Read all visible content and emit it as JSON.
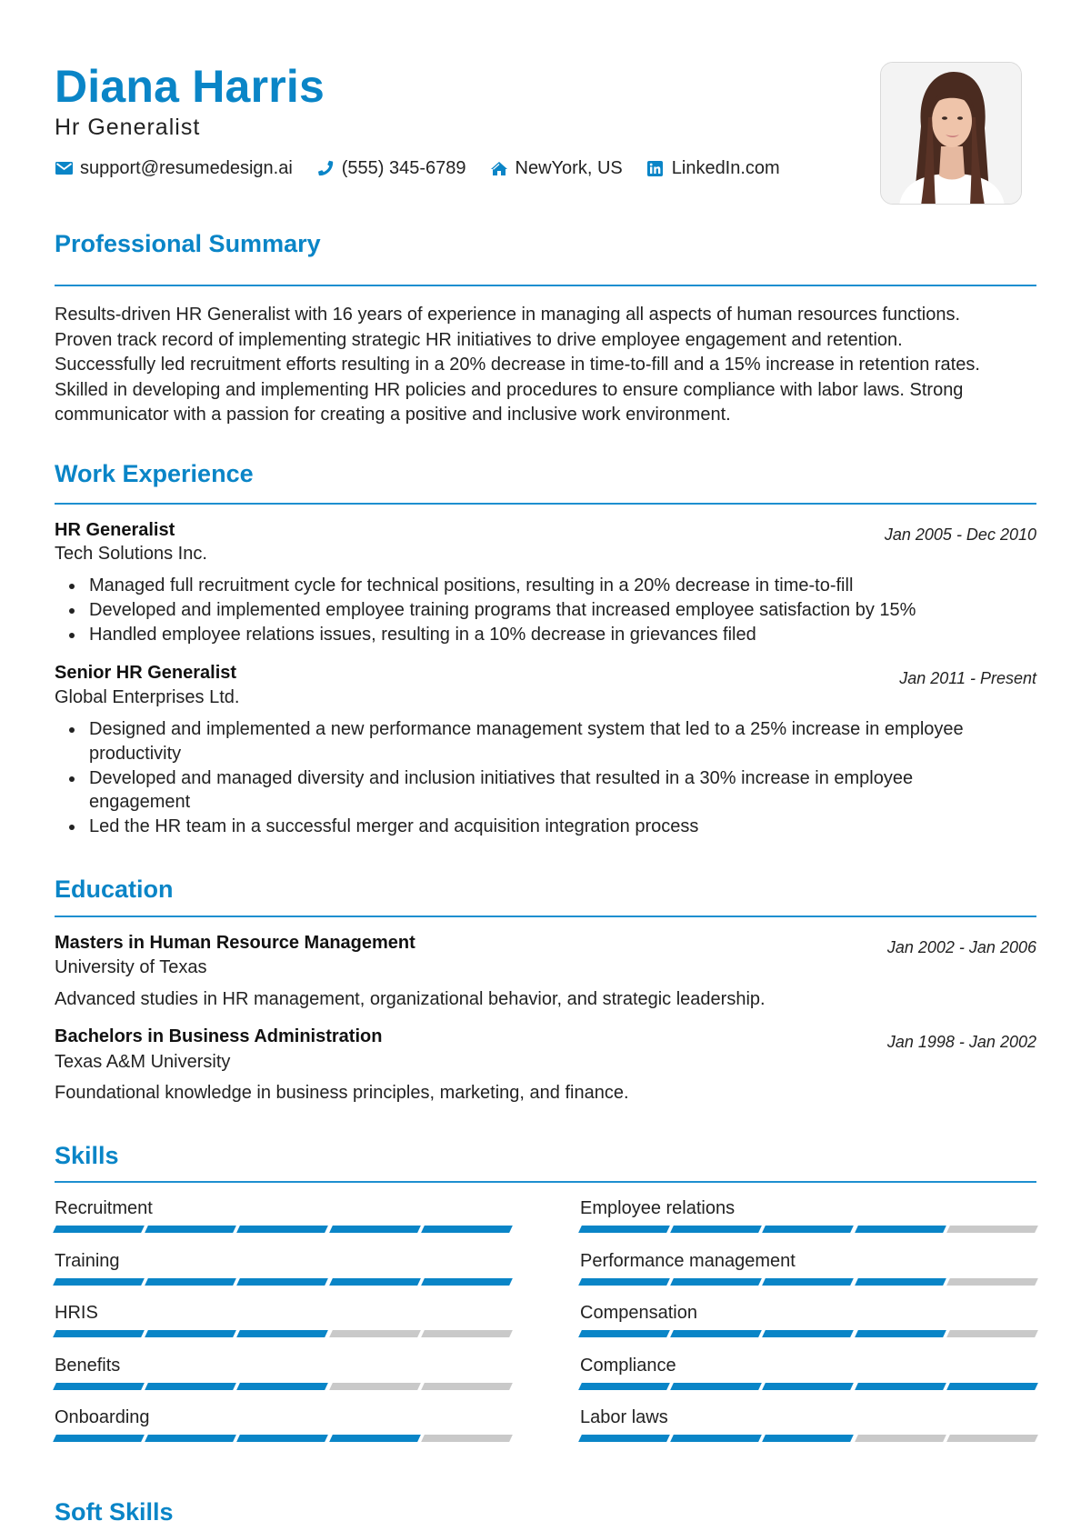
{
  "header": {
    "name": "Diana Harris",
    "title": "Hr Generalist",
    "contacts": [
      {
        "icon": "envelope-icon",
        "label": "support@resumedesign.ai"
      },
      {
        "icon": "phone-icon",
        "label": "(555) 345-6789"
      },
      {
        "icon": "home-icon",
        "label": "NewYork, US"
      },
      {
        "icon": "linkedin-icon",
        "label": "LinkedIn.com"
      }
    ],
    "photo_alt": "Profile photo"
  },
  "colors": {
    "accent": "#0a85c7",
    "skill_empty": "#c9c9c9",
    "text": "#222222"
  },
  "summary": {
    "heading": "Professional Summary",
    "lines": [
      "Results-driven HR Generalist with 16 years of experience in managing all aspects of human resources functions.",
      "Proven track record of implementing strategic HR initiatives to drive employee engagement and retention.",
      "Successfully led recruitment efforts resulting in a 20% decrease in time-to-fill and a 15% increase in retention rates.",
      "Skilled in developing and implementing HR policies and procedures to ensure compliance with labor laws. Strong",
      "communicator with a passion for creating a positive and inclusive work environment."
    ]
  },
  "experience": {
    "heading": "Work Experience",
    "jobs": [
      {
        "role": "HR Generalist",
        "company": "Tech Solutions Inc.",
        "dates": "Jan 2005 - Dec 2010",
        "bullets": [
          "Managed full recruitment cycle for technical positions, resulting in a 20% decrease in time-to-fill",
          "Developed and implemented employee training programs that increased employee satisfaction by 15%",
          "Handled employee relations issues, resulting in a 10% decrease in grievances filed"
        ]
      },
      {
        "role": "Senior HR Generalist",
        "company": "Global Enterprises Ltd.",
        "dates": "Jan 2011 - Present",
        "bullets": [
          "Designed and implemented a new performance management system that led to a 25% increase in employee productivity",
          "Developed and managed diversity and inclusion initiatives that resulted in a 30% increase in employee engagement",
          "Led the HR team in a successful merger and acquisition integration process"
        ]
      }
    ]
  },
  "education": {
    "heading": "Education",
    "items": [
      {
        "degree": "Masters in Human Resource Management",
        "school": "University of Texas",
        "dates": "Jan 2002 - Jan 2006",
        "description": "Advanced studies in HR management, organizational behavior, and strategic leadership."
      },
      {
        "degree": "Bachelors in Business Administration",
        "school": "Texas A&M University",
        "dates": "Jan 1998 - Jan 2002",
        "description": "Foundational knowledge in business principles, marketing, and finance."
      }
    ]
  },
  "skills": {
    "heading": "Skills",
    "max_level": 5,
    "items": [
      {
        "name": "Recruitment",
        "level": 5
      },
      {
        "name": "Employee relations",
        "level": 4
      },
      {
        "name": "Training",
        "level": 5
      },
      {
        "name": "Performance management",
        "level": 4
      },
      {
        "name": "HRIS",
        "level": 3
      },
      {
        "name": "Compensation",
        "level": 4
      },
      {
        "name": "Benefits",
        "level": 3
      },
      {
        "name": "Compliance",
        "level": 5
      },
      {
        "name": "Onboarding",
        "level": 4
      },
      {
        "name": "Labor laws",
        "level": 3
      }
    ]
  },
  "soft_skills": {
    "heading": "Soft Skills"
  }
}
